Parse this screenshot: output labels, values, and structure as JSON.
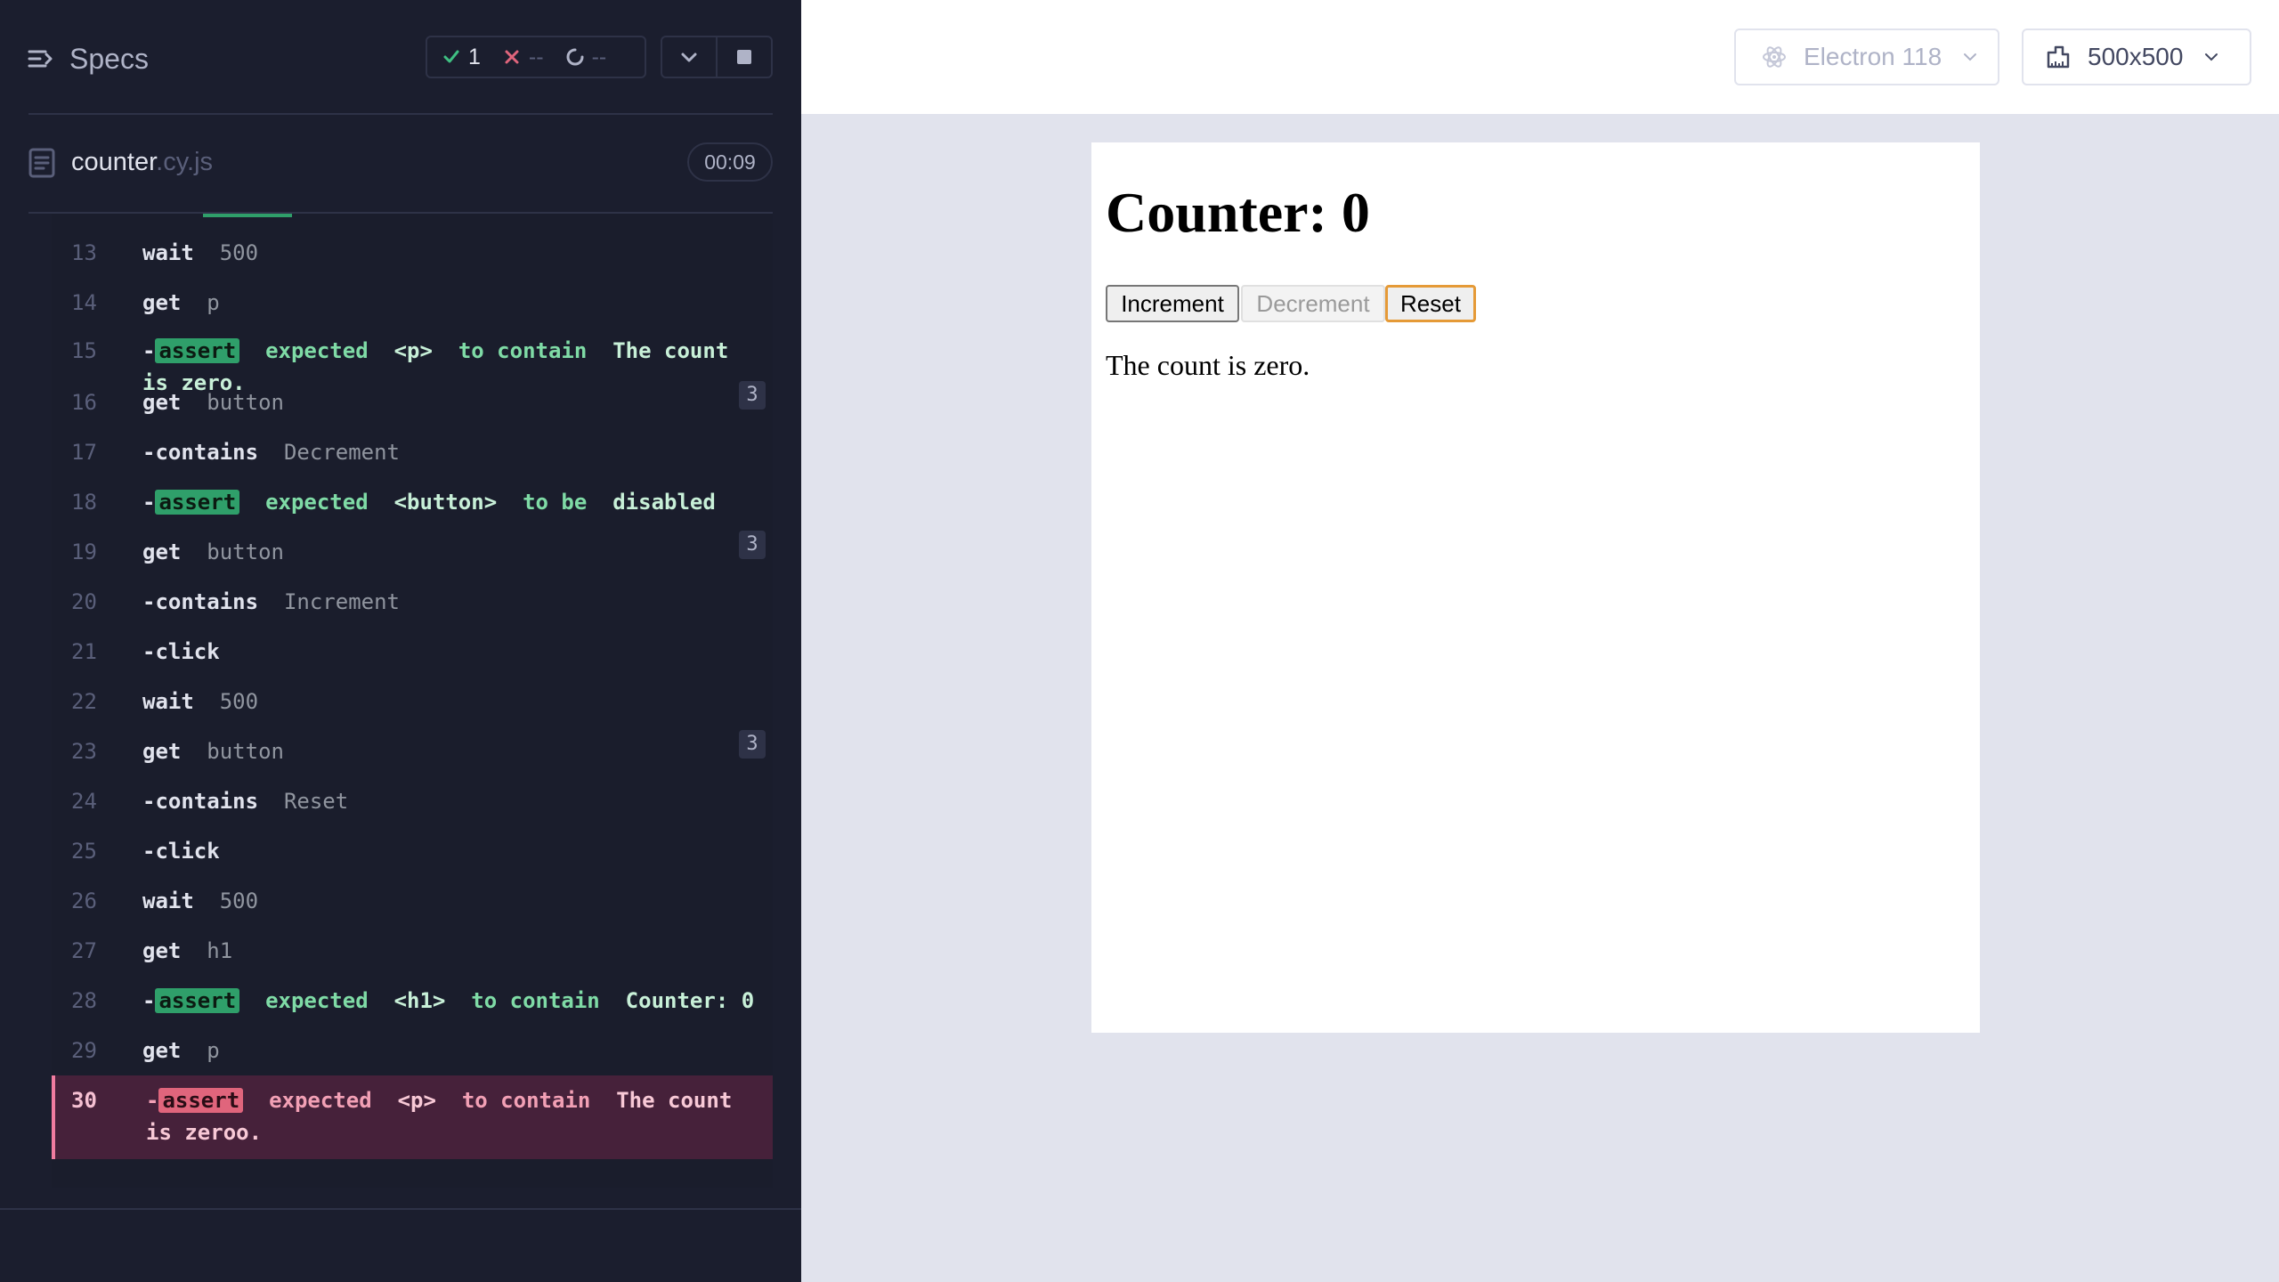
{
  "reporter": {
    "specs_label": "Specs",
    "stats": {
      "passed": "1",
      "failed": "--",
      "pending": "--"
    },
    "spec": {
      "name": "counter",
      "ext": ".cy.js",
      "duration": "00:09"
    },
    "commands": [
      {
        "line": "13",
        "dash": "",
        "name": "wait",
        "arg": "500"
      },
      {
        "line": "14",
        "dash": "",
        "name": "get",
        "arg": "p"
      },
      {
        "line": "15",
        "type": "assert",
        "dash": "-",
        "badge": "assert",
        "expected": "expected",
        "subject": "<p>",
        "verb": "to contain",
        "value": "The count is zero."
      },
      {
        "line": "16",
        "dash": "",
        "name": "get",
        "arg": "button",
        "count": "3"
      },
      {
        "line": "17",
        "dash": "-",
        "name": "contains",
        "arg": "Decrement"
      },
      {
        "line": "18",
        "type": "assert",
        "dash": "-",
        "badge": "assert",
        "expected": "expected",
        "subject": "<button>",
        "verb": "to be",
        "value": "disabled"
      },
      {
        "line": "19",
        "dash": "",
        "name": "get",
        "arg": "button",
        "count": "3"
      },
      {
        "line": "20",
        "dash": "-",
        "name": "contains",
        "arg": "Increment"
      },
      {
        "line": "21",
        "dash": "-",
        "name": "click",
        "arg": ""
      },
      {
        "line": "22",
        "dash": "",
        "name": "wait",
        "arg": "500"
      },
      {
        "line": "23",
        "dash": "",
        "name": "get",
        "arg": "button",
        "count": "3"
      },
      {
        "line": "24",
        "dash": "-",
        "name": "contains",
        "arg": "Reset"
      },
      {
        "line": "25",
        "dash": "-",
        "name": "click",
        "arg": ""
      },
      {
        "line": "26",
        "dash": "",
        "name": "wait",
        "arg": "500"
      },
      {
        "line": "27",
        "dash": "",
        "name": "get",
        "arg": "h1"
      },
      {
        "line": "28",
        "type": "assert",
        "dash": "-",
        "badge": "assert",
        "expected": "expected",
        "subject": "<h1>",
        "verb": "to contain",
        "value": "Counter: 0"
      },
      {
        "line": "29",
        "dash": "",
        "name": "get",
        "arg": "p"
      },
      {
        "line": "30",
        "type": "assert",
        "state": "failed",
        "dash": "-",
        "badge": "assert",
        "expected": "expected",
        "subject": "<p>",
        "verb": "to contain",
        "value": "The count is zeroo."
      }
    ]
  },
  "toolbar": {
    "browser": "Electron 118",
    "viewport": "500x500"
  },
  "app": {
    "heading": "Counter: 0",
    "buttons": {
      "increment": "Increment",
      "decrement": "Decrement",
      "reset": "Reset"
    },
    "message": "The count is zero."
  },
  "colors": {
    "reporter_bg": "#1b1e2e",
    "pass_green": "#2f9f6a",
    "fail_red": "#e0657c",
    "focus_orange": "#e59a37"
  }
}
